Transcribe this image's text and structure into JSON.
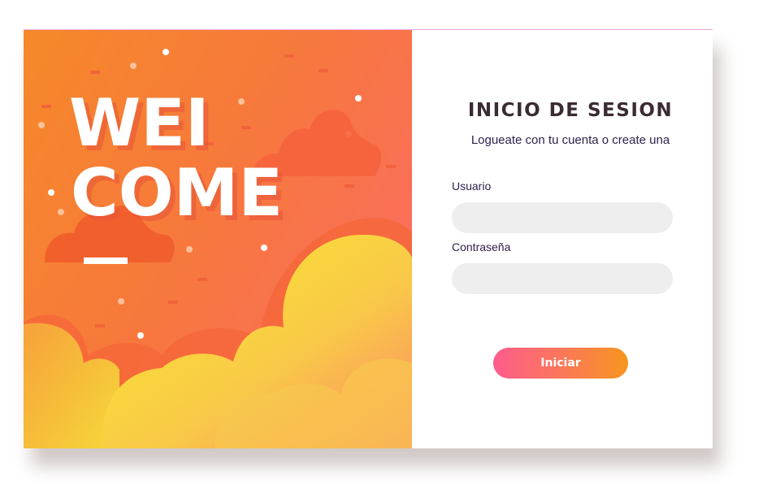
{
  "hero": {
    "line1": "WEI",
    "line2": "COME"
  },
  "login": {
    "title": "INICIO DE SESION",
    "subtitle": "Logueate con tu cuenta o create una",
    "username_label": "Usuario",
    "password_label": "Contraseña",
    "username_value": "",
    "password_value": "",
    "submit_label": "Iniciar"
  },
  "colors": {
    "hero_orange": "#f5892a",
    "hero_pink": "#fb6a6a",
    "cloud_yellow": "#f7e334",
    "title_text": "#3b2b33",
    "label_text": "#2f1f4a",
    "field_bg": "#eeeeee",
    "button_start": "#fd5c8c",
    "button_end": "#f7961e"
  }
}
